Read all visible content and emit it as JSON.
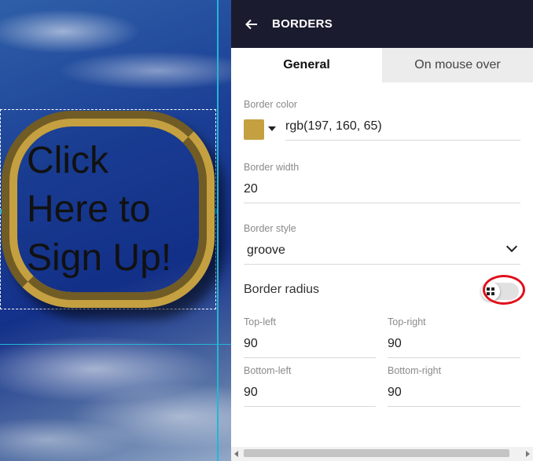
{
  "canvas": {
    "button_text": "Click Here to Sign Up!"
  },
  "panel": {
    "title": "BORDERS",
    "back_icon": "arrow-left-icon",
    "tabs": [
      {
        "label": "General",
        "active": true
      },
      {
        "label": "On mouse over",
        "active": false
      }
    ],
    "border_color": {
      "label": "Border color",
      "value": "rgb(197, 160, 65)",
      "swatch": "#c5a041"
    },
    "border_width": {
      "label": "Border width",
      "value": "20"
    },
    "border_style": {
      "label": "Border style",
      "value": "groove"
    },
    "border_radius": {
      "label": "Border radius",
      "toggle_icon": "grid-icon",
      "top_left": {
        "label": "Top-left",
        "value": "90"
      },
      "top_right": {
        "label": "Top-right",
        "value": "90"
      },
      "bottom_left": {
        "label": "Bottom-left",
        "value": "90"
      },
      "bottom_right": {
        "label": "Bottom-right",
        "value": "90"
      }
    }
  },
  "colors": {
    "header_bg": "#1b1b2f",
    "guide": "#22b6d6",
    "highlight": "#e0101c"
  }
}
